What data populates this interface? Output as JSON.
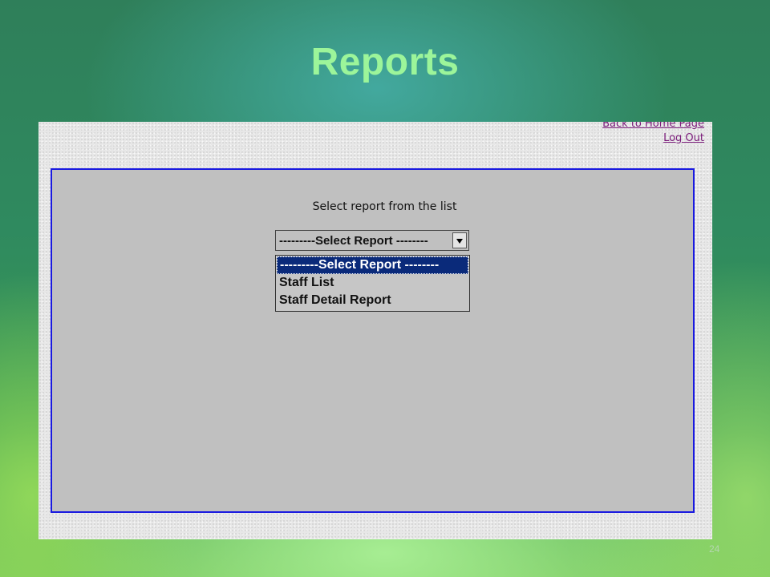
{
  "slide": {
    "title": "Reports",
    "page_number": "24"
  },
  "header_links": {
    "back_link": "Back to Home Page",
    "logout": "Log Out"
  },
  "report_panel": {
    "prompt": "Select report from the list",
    "select": {
      "value": "---------Select Report --------",
      "options": [
        "---------Select Report --------",
        "Staff List",
        "Staff Detail Report"
      ],
      "highlighted_index": 0
    }
  },
  "colors": {
    "title": "#9cf59a",
    "panel_border": "#1a1ae0",
    "panel_bg": "#c0c0c0",
    "link": "#7a1a7a",
    "highlight": "#0a2a7a"
  },
  "icons": {
    "dropdown_arrow": "chevron-down-icon"
  }
}
